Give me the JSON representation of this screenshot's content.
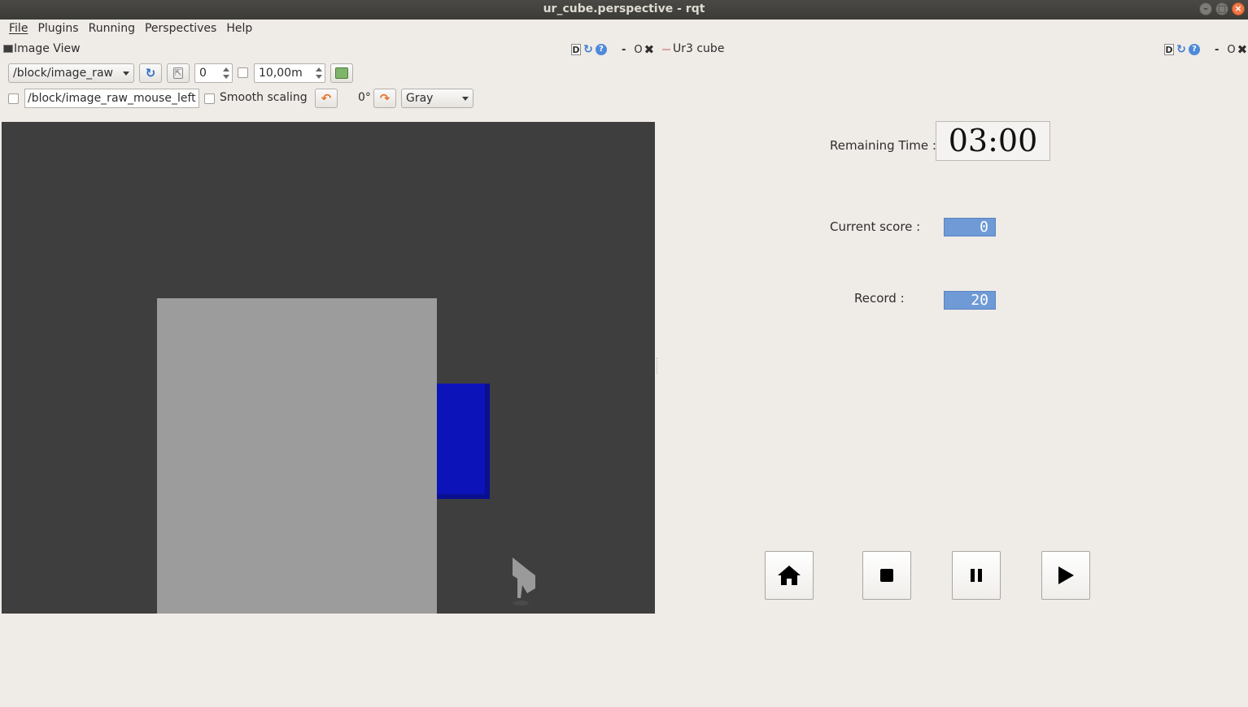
{
  "window": {
    "title": "ur_cube.perspective - rqt"
  },
  "menu": [
    "File",
    "Plugins",
    "Running",
    "Perspectives",
    "Help"
  ],
  "image_view": {
    "title": "Image View",
    "tools": {
      "d": "D",
      "o": "O",
      "dash": "-"
    },
    "topic": "/block/image_raw",
    "spin_value": "0",
    "max_range": "10,00m",
    "mouse_topic": "/block/image_raw_mouse_left",
    "smooth_scaling_label": "Smooth scaling",
    "rotation": "0°",
    "color_scheme": "Gray"
  },
  "ur3_panel": {
    "title": "Ur3 cube",
    "tools": {
      "d": "D",
      "o": "O",
      "dash": "-"
    },
    "remaining_time_label": "Remaining Time :",
    "remaining_time": "03:00",
    "current_score_label": "Current score :",
    "current_score": "0",
    "record_label": "Record :",
    "record": "20"
  },
  "icons": {
    "home": "home-icon",
    "stop": "stop-icon",
    "pause": "pause-icon",
    "play": "play-icon",
    "refresh": "refresh-icon",
    "rotate": "rotate-icon",
    "save": "save-icon"
  },
  "colors": {
    "lcd_bg": "#6f9ad6",
    "cube_blue": "#0c13b8",
    "image_bg": "#3e3e3e"
  }
}
